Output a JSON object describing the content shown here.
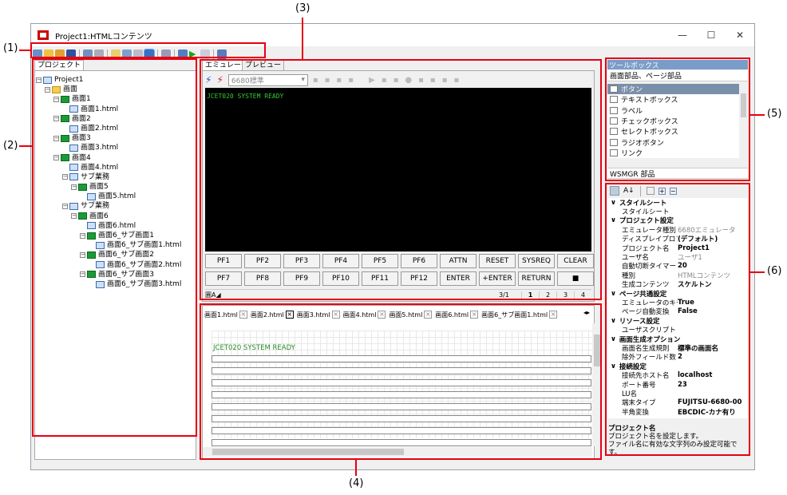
{
  "window": {
    "title": "Project1:HTMLコンテンツ"
  },
  "callouts": [
    "(1)",
    "(2)",
    "(3)",
    "(4)",
    "(5)",
    "(6)"
  ],
  "project_panel": {
    "tab": "プロジェクト"
  },
  "tree": [
    {
      "label": "Project1",
      "indent": 0,
      "icon": "project-icon"
    },
    {
      "label": "画面",
      "indent": 1,
      "icon": "folder-icon"
    },
    {
      "label": "画面1",
      "indent": 2,
      "icon": "screen-icon"
    },
    {
      "label": "画面1.html",
      "indent": 3,
      "icon": "html-icon"
    },
    {
      "label": "画面2",
      "indent": 2,
      "icon": "screen-icon"
    },
    {
      "label": "画面2.html",
      "indent": 3,
      "icon": "html-icon"
    },
    {
      "label": "画面3",
      "indent": 2,
      "icon": "screen-icon"
    },
    {
      "label": "画面3.html",
      "indent": 3,
      "icon": "html-icon"
    },
    {
      "label": "画面4",
      "indent": 2,
      "icon": "screen-icon"
    },
    {
      "label": "画面4.html",
      "indent": 3,
      "icon": "html-icon"
    },
    {
      "label": "サブ業務",
      "indent": 3,
      "icon": "sub-icon"
    },
    {
      "label": "画面5",
      "indent": 4,
      "icon": "screen-icon"
    },
    {
      "label": "画面5.html",
      "indent": 5,
      "icon": "html-icon"
    },
    {
      "label": "サブ業務",
      "indent": 3,
      "icon": "sub-icon"
    },
    {
      "label": "画面6",
      "indent": 4,
      "icon": "screen-icon"
    },
    {
      "label": "画面6.html",
      "indent": 5,
      "icon": "html-icon"
    },
    {
      "label": "画面6_サブ画面1",
      "indent": 5,
      "icon": "screen-icon"
    },
    {
      "label": "画面6_サブ画面1.html",
      "indent": 6,
      "icon": "html-icon"
    },
    {
      "label": "画面6_サブ画面2",
      "indent": 5,
      "icon": "screen-icon"
    },
    {
      "label": "画面6_サブ画面2.html",
      "indent": 6,
      "icon": "html-icon"
    },
    {
      "label": "画面6_サブ画面3",
      "indent": 5,
      "icon": "screen-icon"
    },
    {
      "label": "画面6_サブ画面3.html",
      "indent": 6,
      "icon": "html-icon"
    }
  ],
  "emulator": {
    "tab1": "エミュレータ",
    "tab2": "プレビュー",
    "model": "6680標準",
    "terminal_text": "JCET020 SYSTEM READY"
  },
  "pf_row1": [
    "PF1",
    "PF2",
    "PF3",
    "PF4",
    "PF5",
    "PF6",
    "ATTN",
    "RESET",
    "SYSREQ",
    "CLEAR"
  ],
  "pf_row2": [
    "PF7",
    "PF8",
    "PF9",
    "PF10",
    "PF11",
    "PF12",
    "ENTER",
    "+ENTER",
    "RETURN",
    "■"
  ],
  "status": {
    "left": "圓A◢",
    "page": "3/1",
    "pages": [
      "1",
      "2",
      "3",
      "4"
    ]
  },
  "doc_tabs": [
    "画面1.html",
    "画面2.html",
    "画面3.html",
    "画面4.html",
    "画面5.html",
    "画面6.html",
    "画面6_サブ画面1.html"
  ],
  "editor": {
    "text": "JCET020 SYSTEM READY"
  },
  "toolbox": {
    "title": "ツールボックス",
    "group": "画面部品、ページ部品",
    "items": [
      "ボタン",
      "テキストボックス",
      "ラベル",
      "チェックボックス",
      "セレクトボックス",
      "ラジオボタン",
      "リンク"
    ],
    "group2": "WSMGR 部品"
  },
  "props": [
    {
      "k": "スタイルシート",
      "cat": true
    },
    {
      "k": "スタイルシート",
      "v": ""
    },
    {
      "k": "プロジェクト設定",
      "cat": true
    },
    {
      "k": "エミュレータ種別",
      "v": "6680エミュレータ",
      "gray": true
    },
    {
      "k": "ディスプレイプロファ",
      "v": "(デフォルト)"
    },
    {
      "k": "プロジェクト名",
      "v": "Project1"
    },
    {
      "k": "ユーザ名",
      "v": "ユーザ1",
      "gray": true
    },
    {
      "k": "自動切断タイマー",
      "v": "20"
    },
    {
      "k": "種別",
      "v": "HTMLコンテンツ",
      "gray": true
    },
    {
      "k": "生成コンテンツ",
      "v": "スケルトン"
    },
    {
      "k": "ページ共通設定",
      "cat": true
    },
    {
      "k": "エミュレータのキー",
      "v": "True"
    },
    {
      "k": "ページ自動変換",
      "v": "False"
    },
    {
      "k": "リソース設定",
      "cat": true
    },
    {
      "k": "ユーザスクリプト",
      "v": ""
    },
    {
      "k": "画面生成オプション",
      "cat": true
    },
    {
      "k": "画面名生成規則",
      "v": "標準の画面名"
    },
    {
      "k": "除外フィールド数",
      "v": "2"
    },
    {
      "k": "接続設定",
      "cat": true
    },
    {
      "k": "接続先ホスト名",
      "v": "localhost"
    },
    {
      "k": "ポート番号",
      "v": "23"
    },
    {
      "k": "LU名",
      "v": ""
    },
    {
      "k": "端末タイプ",
      "v": "FUJITSU-6680-00"
    },
    {
      "k": "半角変換",
      "v": "EBCDIC-カナ有り"
    }
  ],
  "prop_desc": {
    "title": "プロジェクト名",
    "line1": "プロジェクト名を設定します。",
    "line2": "ファイル名に有効な文字列のみ設定可能です。"
  }
}
